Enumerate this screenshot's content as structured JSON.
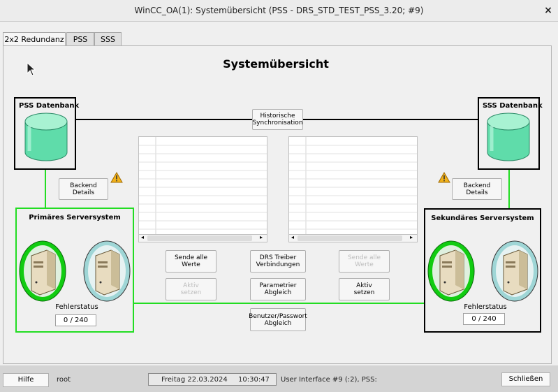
{
  "window": {
    "title": "WinCC_OA(1): Systemübersicht (PSS - DRS_STD_TEST_PSS_3.20; #9)",
    "close_glyph": "×"
  },
  "tabs": [
    {
      "label": "2x2 Redundanz",
      "active": true
    },
    {
      "label": "PSS",
      "active": false
    },
    {
      "label": "SSS",
      "active": false
    }
  ],
  "page_title": "Systemübersicht",
  "pss_db": {
    "title": "PSS Datenbank"
  },
  "sss_db": {
    "title": "SSS Datenbank"
  },
  "buttons": {
    "historische": "Historische\nSynchronisation",
    "backend_left": "Backend\nDetails",
    "backend_right": "Backend\nDetails",
    "sende_left": "Sende alle\nWerte",
    "drs_treiber": "DRS Treiber\nVerbindungen",
    "sende_right": "Sende alle\nWerte",
    "aktiv_left": "Aktiv\nsetzen",
    "parametrier": "Parametrier\nAbgleich",
    "aktiv_right": "Aktiv\nsetzen",
    "benutzer": "Benutzer/Passwort\nAbgleich"
  },
  "primary": {
    "title": "Primäres Serversystem",
    "fehler_label": "Fehlerstatus",
    "fehler_value": "0 / 240"
  },
  "secondary": {
    "title": "Sekundäres Serversystem",
    "fehler_label": "Fehlerstatus",
    "fehler_value": "0 / 240"
  },
  "statusbar": {
    "hilfe": "Hilfe",
    "user": "root",
    "date": "Freitag 22.03.2024",
    "time": "10:30:47",
    "info": "User Interface #9 (:2), PSS:",
    "schliessen": "Schließen"
  },
  "colors": {
    "green_link": "#22dd22",
    "db_cylinder": "#7eeac0",
    "server_active_ring": "#11cc11",
    "server_passive_ring": "#9fd6d6",
    "warning": "#f2b21a"
  },
  "icons": {
    "warning": "warning-icon",
    "database": "database-icon",
    "server": "server-icon",
    "cursor": "mouse-cursor-icon"
  }
}
